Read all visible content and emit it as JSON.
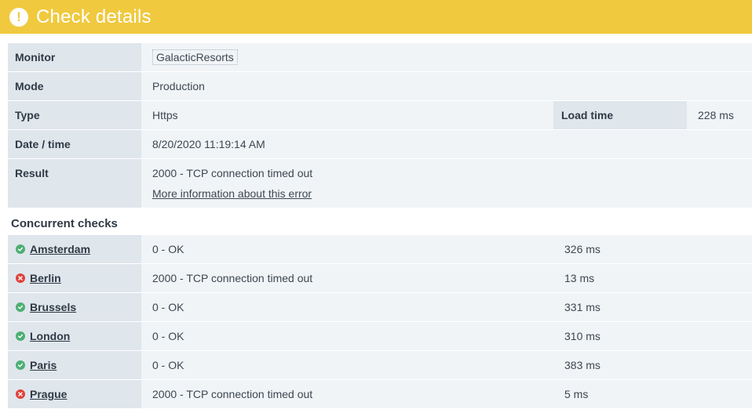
{
  "header": {
    "title": "Check details",
    "icon": "alert-icon",
    "color": "#f0c93f"
  },
  "details": {
    "monitor_label": "Monitor",
    "monitor_value": "GalacticResorts",
    "mode_label": "Mode",
    "mode_value": "Production",
    "type_label": "Type",
    "type_value": "Https",
    "load_label": "Load time",
    "load_value": "228 ms",
    "datetime_label": "Date / time",
    "datetime_value": "8/20/2020 11:19:14 AM",
    "result_label": "Result",
    "result_value": "2000 - TCP connection timed out",
    "result_link": "More information about this error"
  },
  "concurrent": {
    "title": "Concurrent checks",
    "rows": [
      {
        "city": "Amsterdam",
        "status": "0 - OK",
        "time": "326 ms",
        "ok": true
      },
      {
        "city": "Berlin",
        "status": "2000 - TCP connection timed out",
        "time": "13 ms",
        "ok": false
      },
      {
        "city": "Brussels",
        "status": "0 - OK",
        "time": "331 ms",
        "ok": true
      },
      {
        "city": "London",
        "status": "0 - OK",
        "time": "310 ms",
        "ok": true
      },
      {
        "city": "Paris",
        "status": "0 - OK",
        "time": "383 ms",
        "ok": true
      },
      {
        "city": "Prague",
        "status": "2000 - TCP connection timed out",
        "time": "5 ms",
        "ok": false
      }
    ]
  }
}
